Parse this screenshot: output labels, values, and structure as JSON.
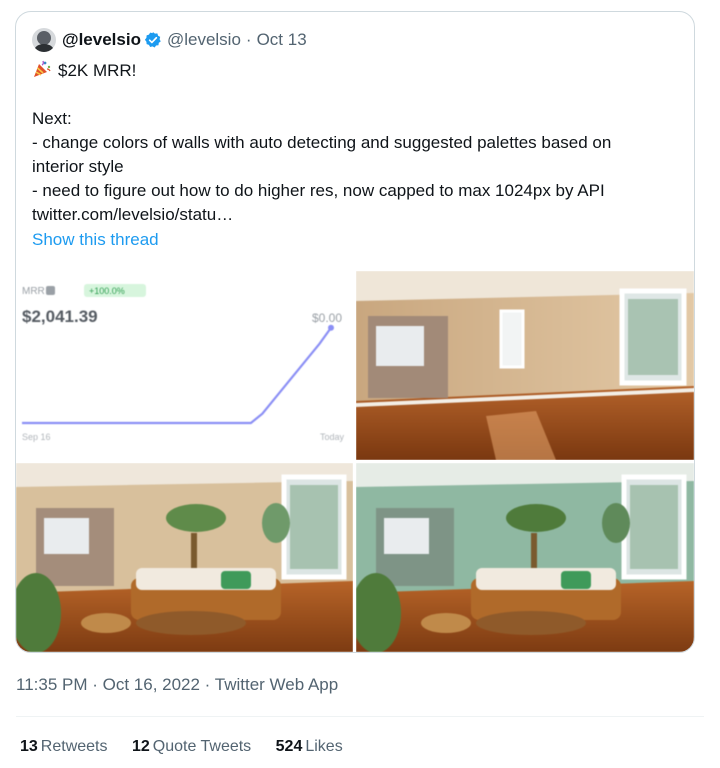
{
  "tweet": {
    "author": {
      "display_name": "@levelsio",
      "handle": "@levelsio",
      "verified": true,
      "avatar_icon": "avatar-photo"
    },
    "separator": "·",
    "date": "Oct 13",
    "emoji_icon": "party-popper-icon",
    "lines": [
      "$2K MRR!",
      "",
      "Next:",
      "- change colors of walls with auto detecting and suggested palettes based on",
      "interior style",
      "- need to figure out how to do higher res, now capped to max 1024px by API",
      "twitter.com/levelsio/statu…"
    ],
    "show_thread": "Show this thread"
  },
  "media": {
    "chart": {
      "label": "MRR",
      "change_badge": "+100.0%",
      "value": "$2,041.39",
      "right_value": "$0.00",
      "x_start": "Sep 16",
      "x_end": "Today",
      "line_color": "#8b8ff5",
      "badge_bg": "#d7f5dd"
    }
  },
  "chart_data": {
    "type": "line",
    "title": "MRR",
    "x": [
      "Sep 16",
      "",
      "",
      "",
      "",
      "",
      "",
      "",
      "",
      "",
      "",
      "",
      "",
      "",
      "",
      "",
      "",
      "",
      "",
      "",
      "",
      "",
      "",
      "",
      "",
      "",
      "",
      "Today"
    ],
    "series": [
      {
        "values": [
          0,
          0,
          0,
          0,
          0,
          0,
          0,
          0,
          0,
          0,
          0,
          0,
          0,
          0,
          0,
          0,
          0,
          0,
          0,
          0,
          0,
          200,
          500,
          800,
          1100,
          1400,
          1700,
          2041.39
        ]
      }
    ],
    "ylim": [
      0,
      2400
    ],
    "grid": false
  },
  "meta": {
    "timestamp": "11:35 PM · Oct 16, 2022 · Twitter Web App"
  },
  "stats": {
    "retweets_count": "13",
    "retweets_label": "Retweets",
    "quotes_count": "12",
    "quotes_label": "Quote Tweets",
    "likes_count": "524",
    "likes_label": "Likes"
  },
  "colors": {
    "link": "#1d9bf0",
    "muted": "#536471",
    "verified": "#1d9bf0"
  }
}
